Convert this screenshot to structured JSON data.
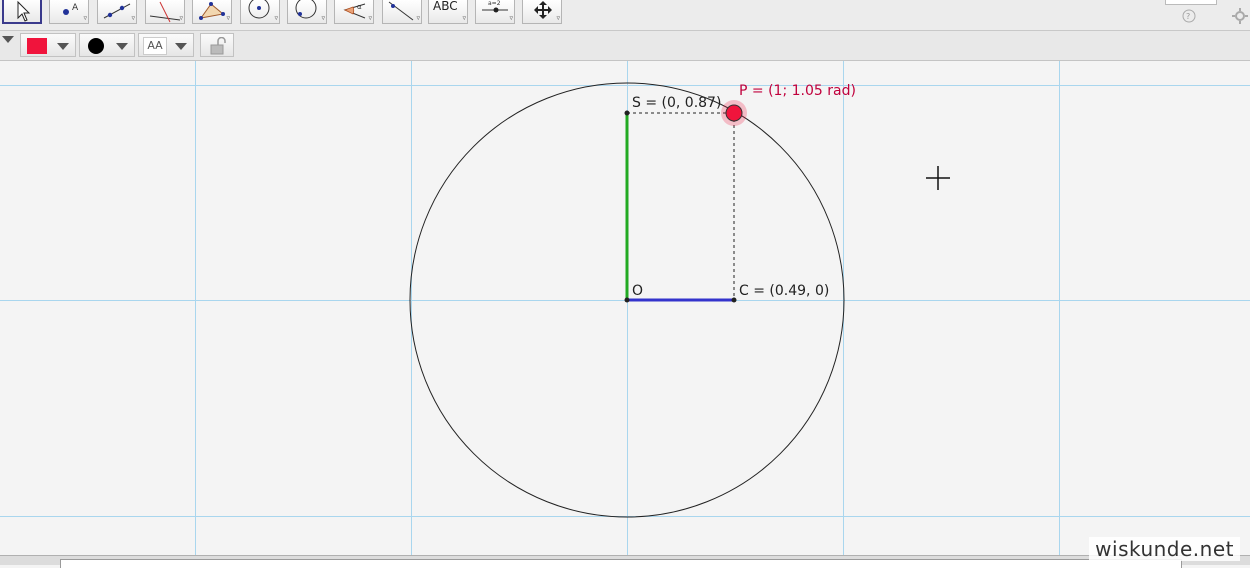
{
  "toolbar": {
    "tools": [
      {
        "name": "move-tool-icon"
      },
      {
        "name": "point-tool-icon"
      },
      {
        "name": "line-tool-icon"
      },
      {
        "name": "perpendicular-tool-icon"
      },
      {
        "name": "polygon-tool-icon"
      },
      {
        "name": "circle-center-point-tool-icon"
      },
      {
        "name": "circle-through-point-tool-icon"
      },
      {
        "name": "angle-tool-icon"
      },
      {
        "name": "reflect-tool-icon"
      },
      {
        "name": "text-tool-icon",
        "label": "ABC"
      },
      {
        "name": "slider-tool-icon"
      },
      {
        "name": "move-view-tool-icon"
      }
    ],
    "help_icon": "help-icon",
    "settings_icon": "gear-icon"
  },
  "style_bar": {
    "color_value": "#f0143c",
    "point_style_color": "#000000",
    "text_style_label": "AA",
    "lock_icon": "lock-icon"
  },
  "graphics": {
    "labels": {
      "P": "P = (1; 1.05 rad)",
      "S": "S = (0, 0.87)",
      "O": "O",
      "C": "C = (0.49, 0)"
    },
    "colors": {
      "point_P": "#f0143c",
      "label_P": "#c0003c",
      "segment_S": "#22aa22",
      "segment_C": "#3333cc",
      "grid": "#a9d6ee"
    }
  },
  "watermark": "wiskunde.net"
}
